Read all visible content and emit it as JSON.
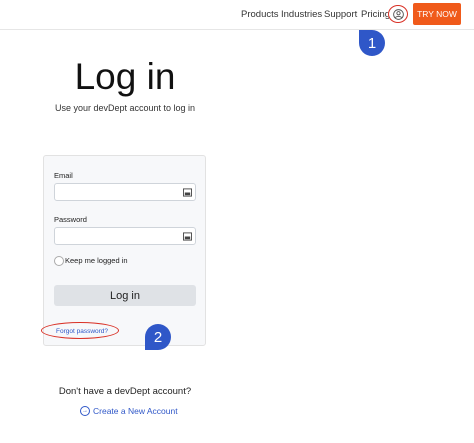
{
  "nav": {
    "items": [
      "Products",
      "Industries",
      "Support",
      "Pricing"
    ],
    "try_now": "TRY NOW"
  },
  "annotations": {
    "marker1": "1",
    "marker2": "2"
  },
  "login": {
    "title": "Log in",
    "subtitle": "Use your devDept account to log in",
    "email_label": "Email",
    "password_label": "Password",
    "keep_logged_in": "Keep me logged in",
    "button": "Log in",
    "forgot": "Forgot password?"
  },
  "signup": {
    "prompt": "Don't have a devDept account?",
    "create": "Create a New Account",
    "create_icon": "→"
  },
  "colors": {
    "accent": "#f05a1a",
    "link": "#2f57c8",
    "highlight": "#d93025"
  }
}
